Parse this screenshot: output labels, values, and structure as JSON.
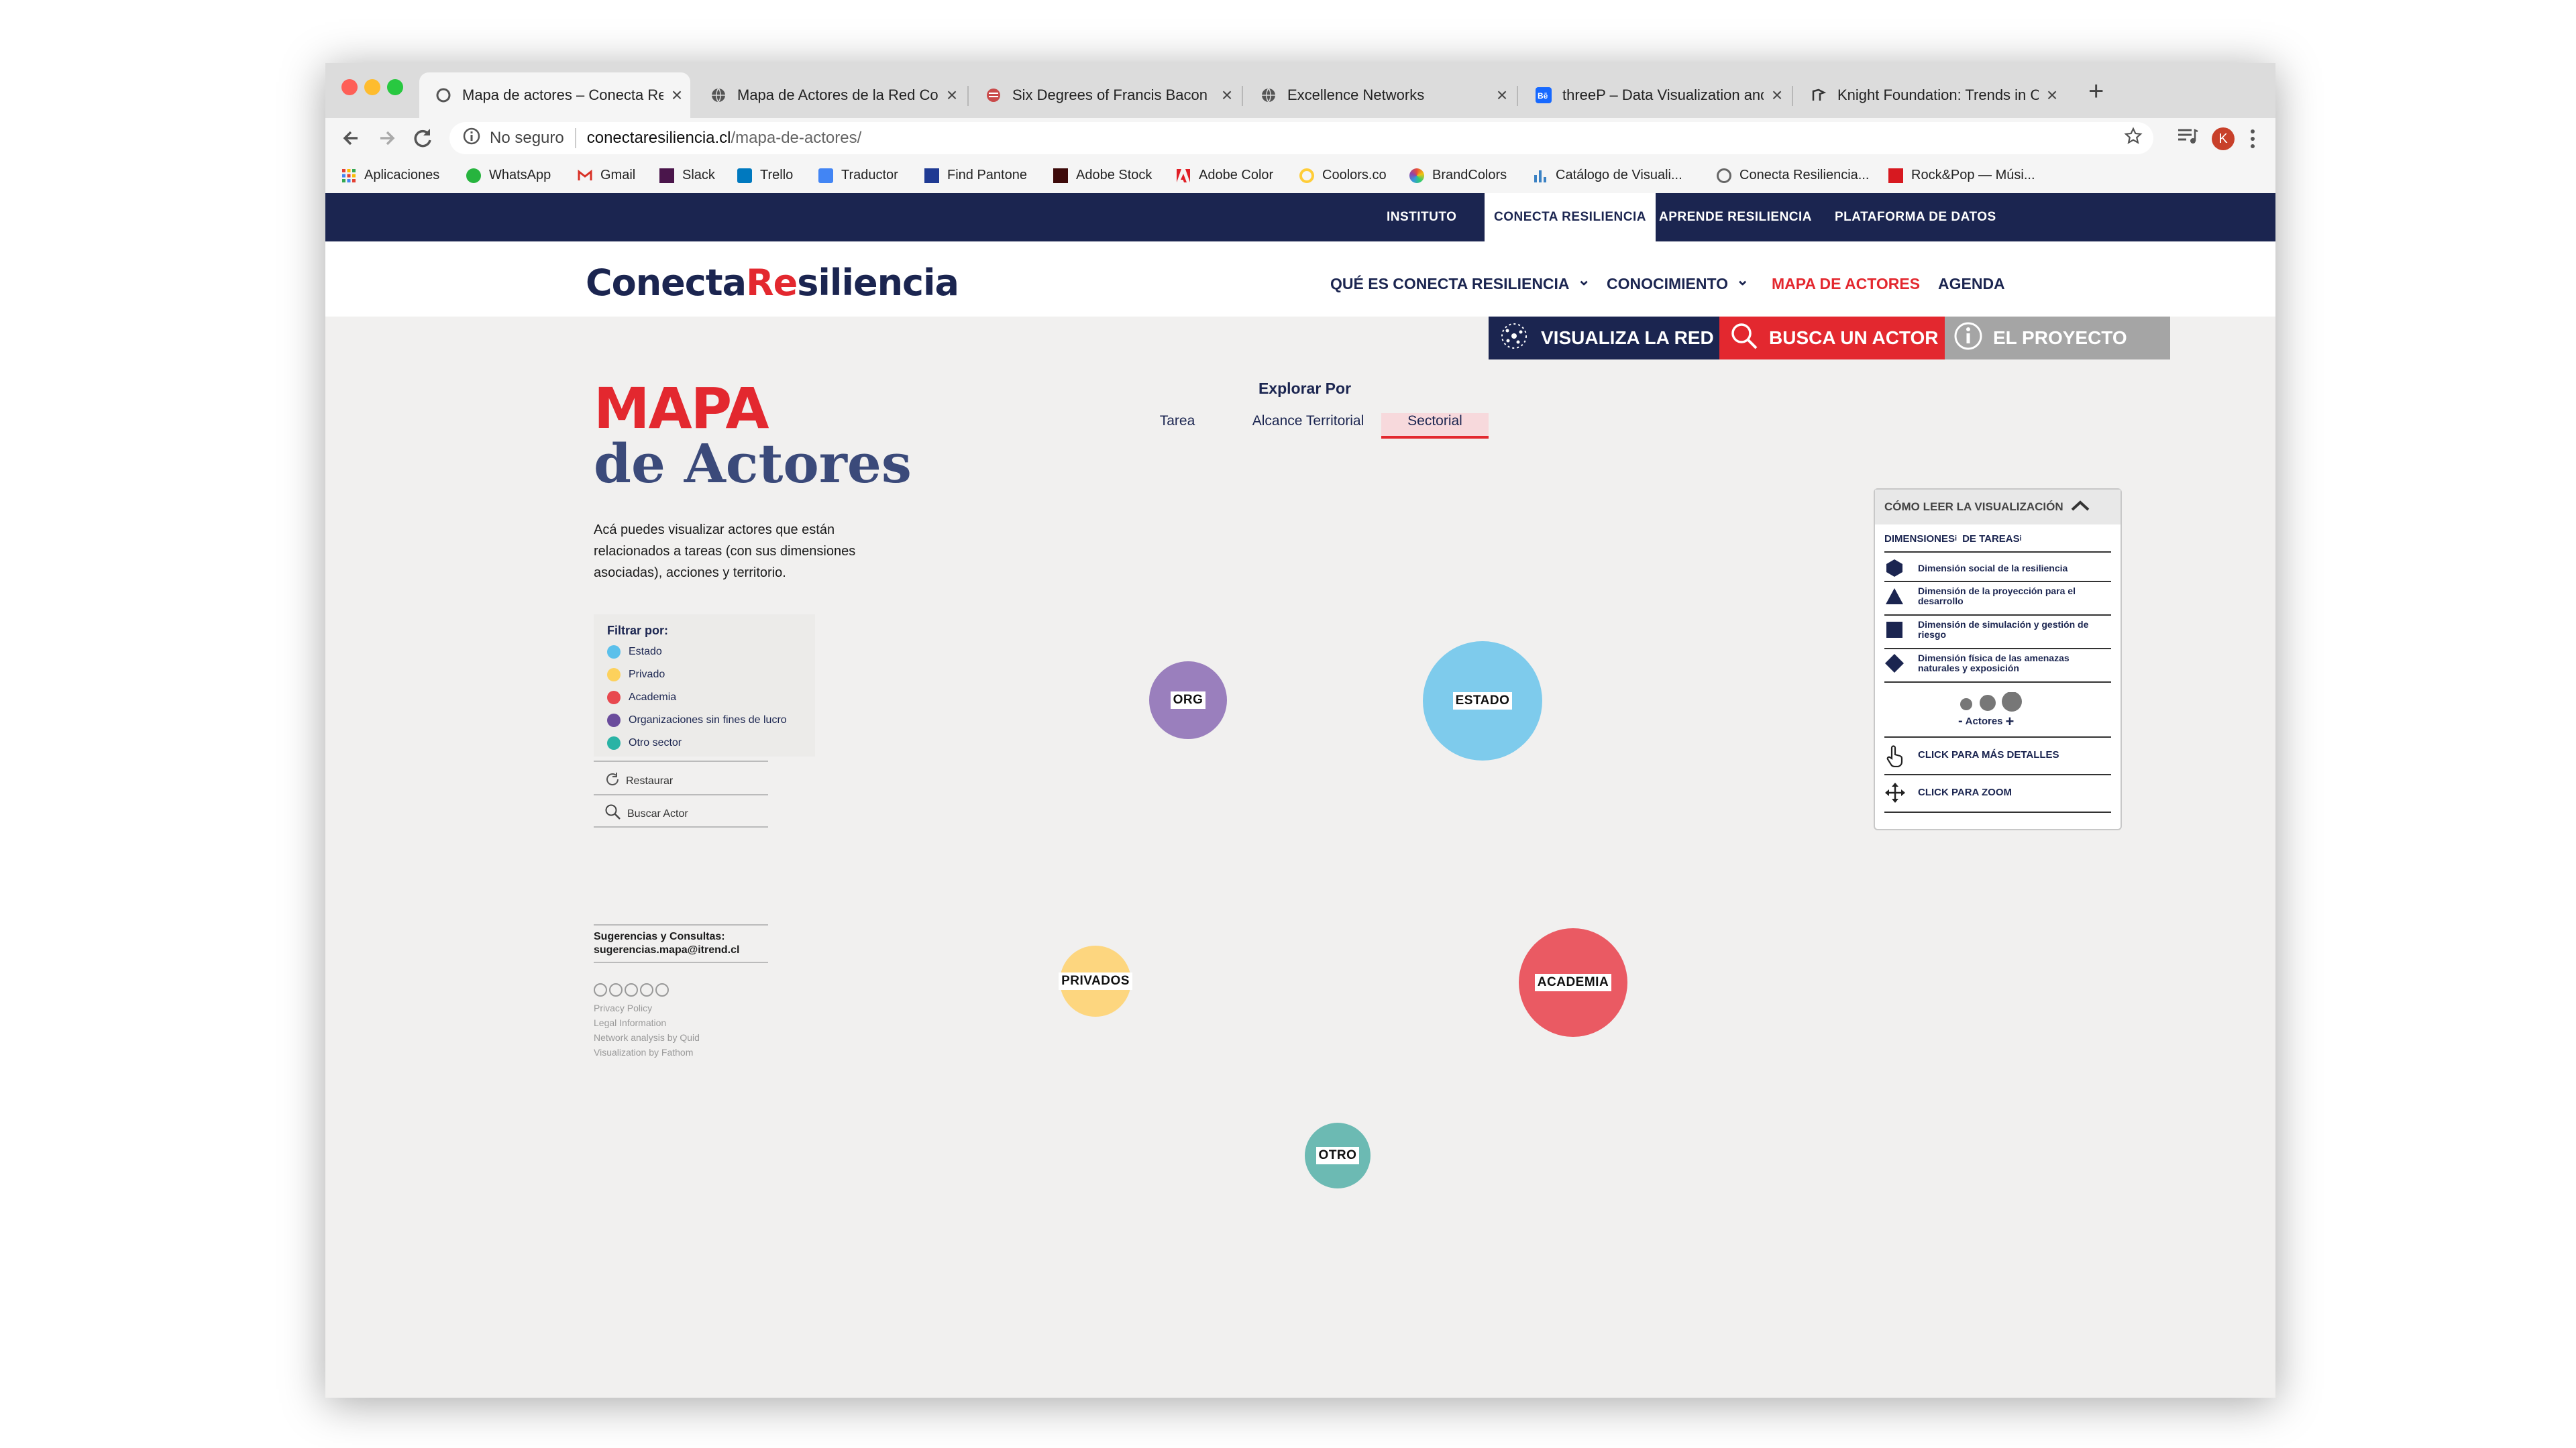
{
  "browser": {
    "tabs": [
      {
        "title": "Mapa de actores – Conecta Resi",
        "active": true,
        "icon": "spinner-icon"
      },
      {
        "title": "Mapa de Actores de la Red Con",
        "active": false,
        "icon": "globe-icon"
      },
      {
        "title": "Six Degrees of Francis Bacon",
        "active": false,
        "icon": "bacon-icon"
      },
      {
        "title": "Excellence Networks",
        "active": false,
        "icon": "globe-icon"
      },
      {
        "title": "threeP – Data Visualization and",
        "active": false,
        "icon": "behance-icon"
      },
      {
        "title": "Knight Foundation: Trends in Civ",
        "active": false,
        "icon": "knight-icon"
      }
    ],
    "tab_close": "×",
    "new_tab": "+",
    "security": "No seguro",
    "url_domain": "conectaresiliencia.cl",
    "url_path": "/mapa-de-actores/",
    "profile_initial": "K",
    "bookmarks": [
      {
        "label": "Aplicaciones",
        "color": "#e34133"
      },
      {
        "label": "WhatsApp",
        "color": "#27b43e"
      },
      {
        "label": "Gmail",
        "color": "#d93025"
      },
      {
        "label": "Slack",
        "color": "#4a154b"
      },
      {
        "label": "Trello",
        "color": "#0079bf"
      },
      {
        "label": "Traductor",
        "color": "#4285f4"
      },
      {
        "label": "Find Pantone",
        "color": "#1f3a93"
      },
      {
        "label": "Adobe Stock",
        "color": "#3d0a0a"
      },
      {
        "label": "Adobe Color",
        "color": "#e01f26"
      },
      {
        "label": "Coolors.co",
        "color": "#ffcd38"
      },
      {
        "label": "BrandColors",
        "color": "#8e44ad"
      },
      {
        "label": "Catálogo de Visuali...",
        "color": "#3b82c4"
      },
      {
        "label": "Conecta Resiliencia...",
        "color": "#888888"
      },
      {
        "label": "Rock&Pop — Músi...",
        "color": "#d71920"
      }
    ]
  },
  "site": {
    "topbar": [
      "INSTITUTO",
      "CONECTA RESILIENCIA",
      "APRENDE RESILIENCIA",
      "PLATAFORMA DE DATOS"
    ],
    "logo_a": "Conecta",
    "logo_b": "Re",
    "logo_c": "siliencia",
    "nav": [
      "QUÉ ES CONECTA RESILIENCIA",
      "CONOCIMIENTO",
      "MAPA DE ACTORES",
      "AGENDA"
    ],
    "chevron": "⌄",
    "actions": [
      "VISUALIZA LA RED",
      "BUSCA UN ACTOR",
      "EL PROYECTO"
    ],
    "colors": {
      "navy": "#1b2550",
      "red": "#e3282f",
      "grey": "#a5a5a5"
    }
  },
  "page": {
    "title_1": "MAPA",
    "title_2": "de Actores",
    "description": "Acá puedes visualizar actores que están relacionados a tareas (con sus dimensiones asociadas), acciones y territorio.",
    "explore_title": "Explorar Por",
    "explore_options": [
      "Tarea",
      "Alcance Territorial",
      "Sectorial"
    ],
    "explore_selected": "Sectorial",
    "filter_title": "Filtrar por:",
    "filters": [
      {
        "label": "Estado",
        "color": "#5bc0eb"
      },
      {
        "label": "Privado",
        "color": "#fdd15c"
      },
      {
        "label": "Academia",
        "color": "#e8484f"
      },
      {
        "label": "Organizaciones sin fines de lucro",
        "color": "#6a4c9c"
      },
      {
        "label": "Otro sector",
        "color": "#2ab3a5"
      }
    ],
    "restore": "Restaurar",
    "search_actor": "Buscar Actor",
    "contact_title": "Sugerencias y Consultas:",
    "contact_email": "sugerencias.mapa@itrend.cl",
    "footer_links": [
      "Privacy Policy",
      "Legal Information",
      "Network analysis by Quid",
      "Visualization by Fathom"
    ]
  },
  "bubbles": [
    {
      "label": "ORG",
      "color": "#9a7fbd"
    },
    {
      "label": "ESTADO",
      "color": "#7ecbec"
    },
    {
      "label": "PRIVADOS",
      "color": "#fdd67f"
    },
    {
      "label": "ACADEMIA",
      "color": "#ea5a63"
    },
    {
      "label": "OTRO",
      "color": "#6cbab3"
    }
  ],
  "legend": {
    "title": "CÓMO LEER LA VISUALIZACIÓN",
    "dim_a": "DIMENSIONES",
    "dim_b": "DE TAREAS",
    "info": "i",
    "rows": [
      {
        "label": "Dimensión social de la resiliencia",
        "shape": "hexagon-icon"
      },
      {
        "label": "Dimensión de la proyección para el desarrollo",
        "shape": "triangle-icon"
      },
      {
        "label": "Dimensión de simulación y gestión de riesgo",
        "shape": "square-icon"
      },
      {
        "label": "Dimensión física de las amenazas naturales y exposición",
        "shape": "diamond-icon"
      }
    ],
    "size_minus": "-",
    "size_label": "Actores",
    "size_plus": "+",
    "click_details": "CLICK PARA MÁS DETALLES",
    "click_zoom": "CLICK PARA ZOOM"
  }
}
